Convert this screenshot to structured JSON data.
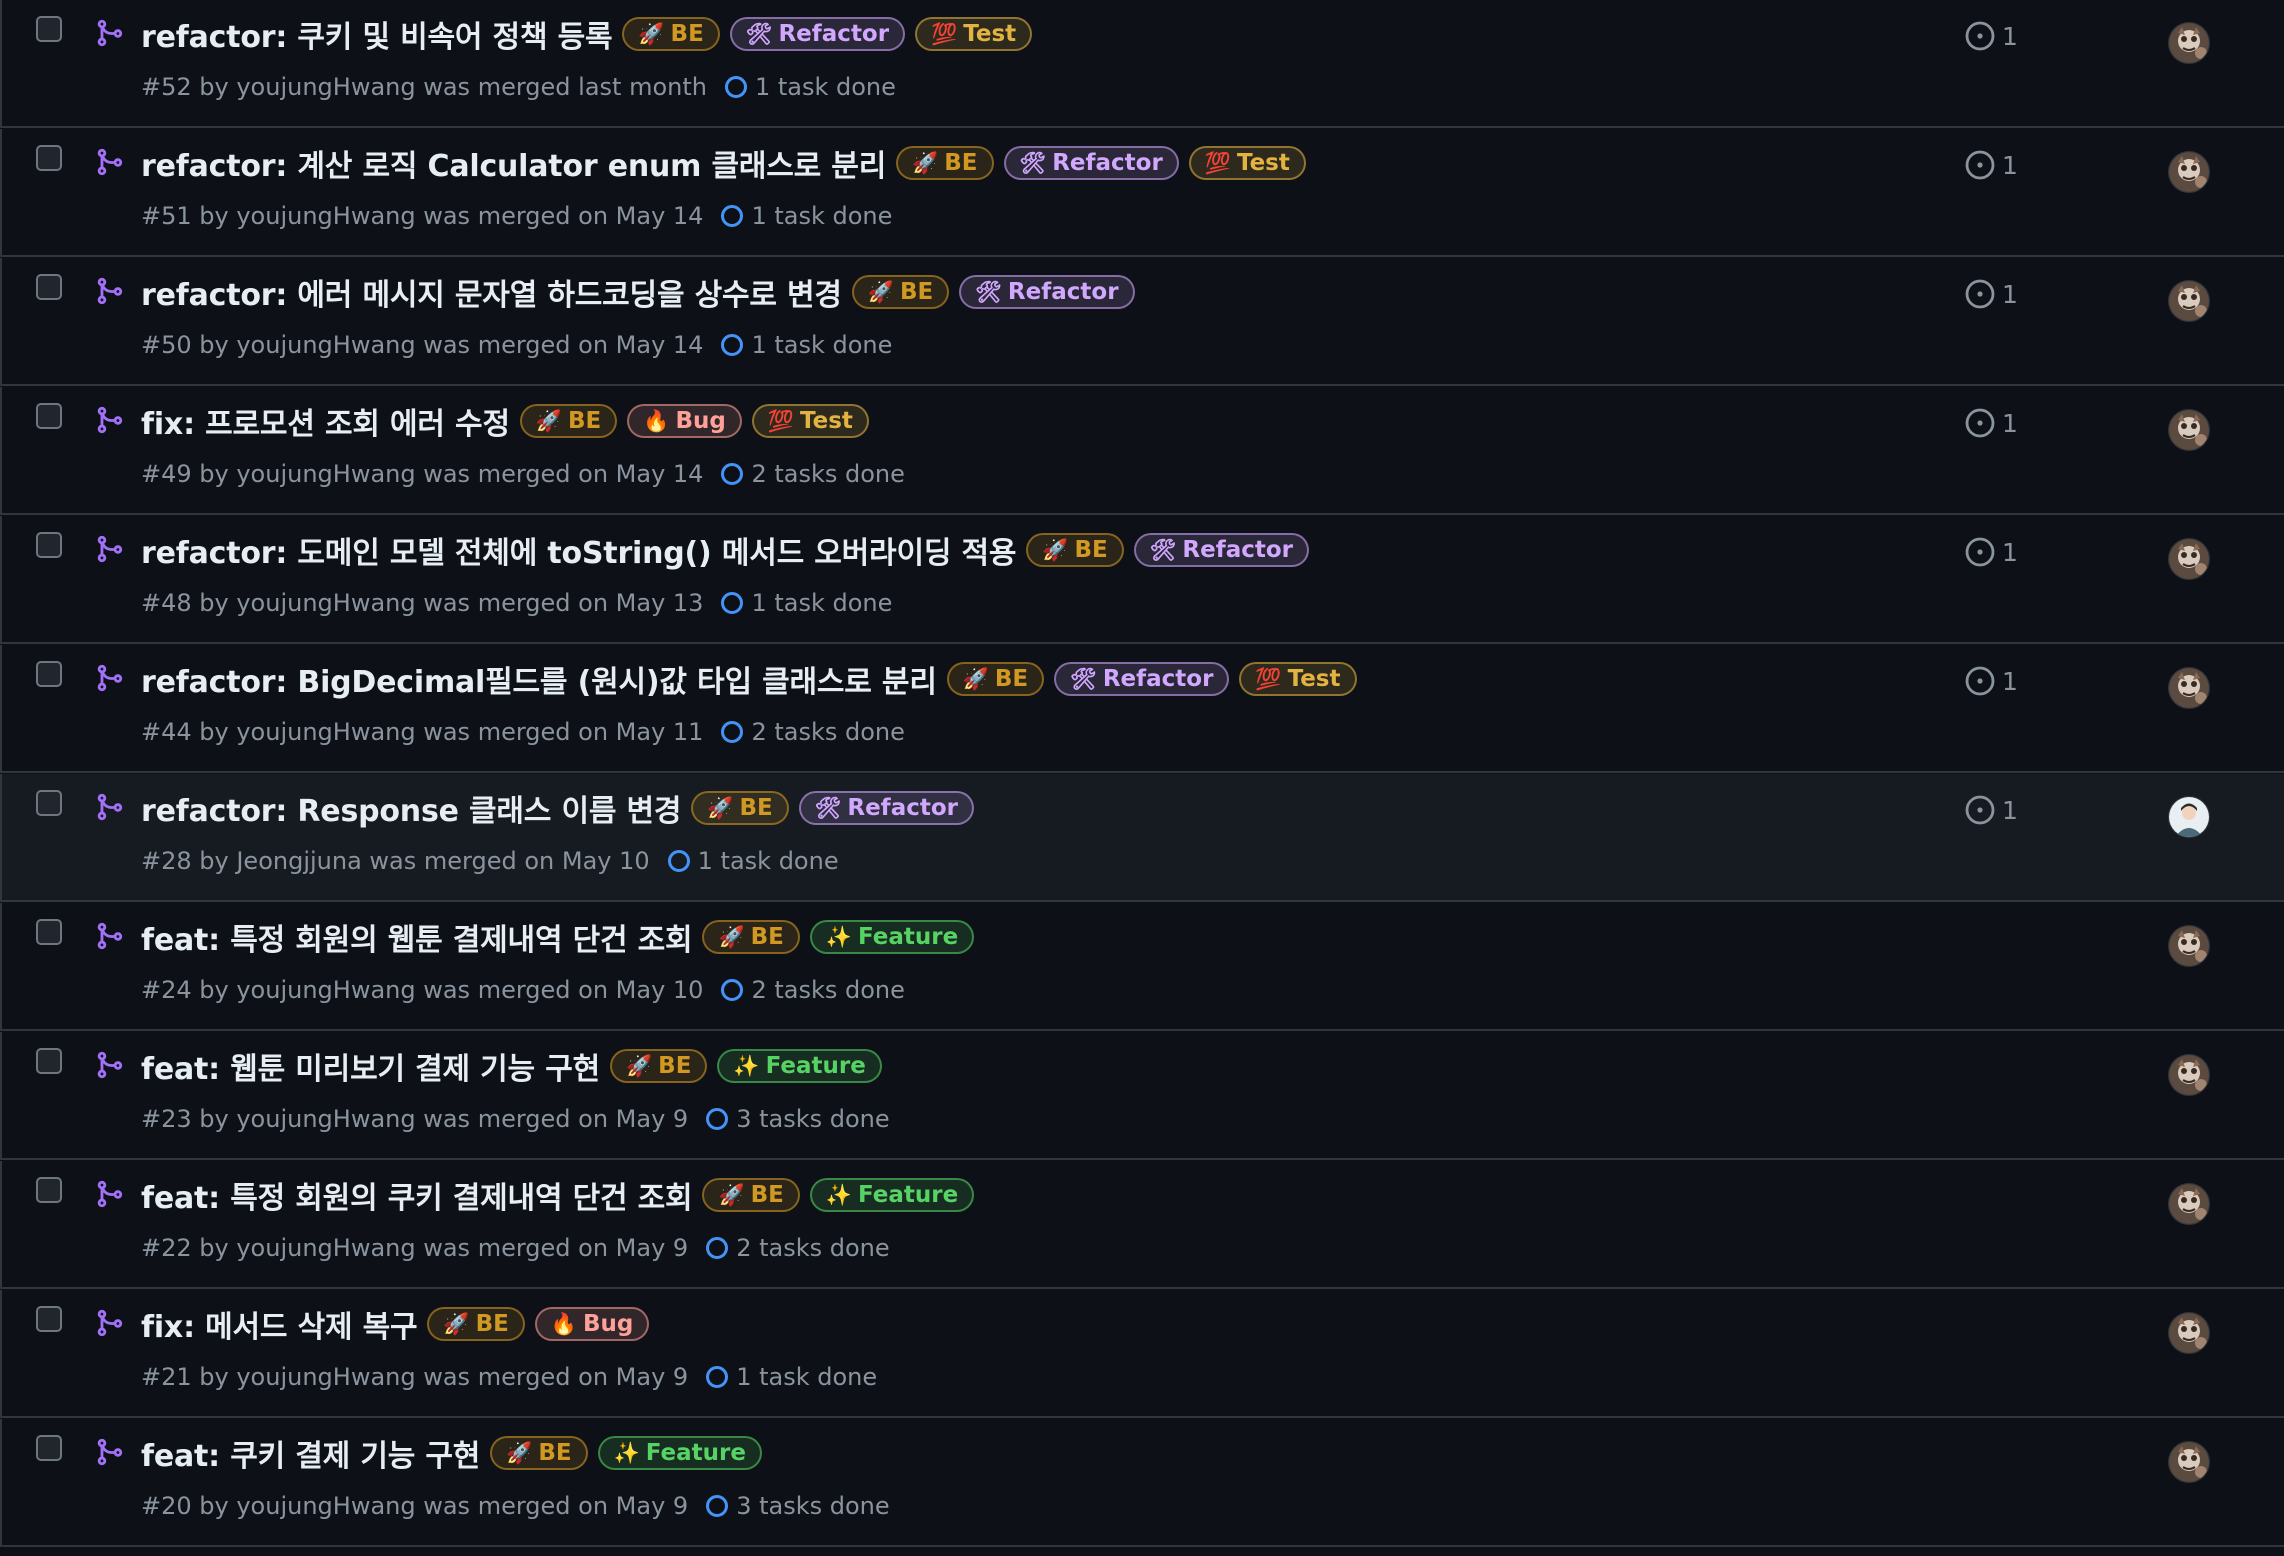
{
  "pull_requests": [
    {
      "title": "refactor: 쿠키 및 비속어 정책 등록",
      "meta": "#52 by youjungHwang was merged last month",
      "tasks": "1 task done",
      "comments": "1",
      "avatar": "youjungHwang",
      "labels": [
        {
          "icon": "🚀",
          "text": "BE",
          "color": "#d29922"
        },
        {
          "icon": "🛠",
          "text": "Refactor",
          "color": "#d2a8ff"
        },
        {
          "icon": "💯",
          "text": "Test",
          "color": "#e3b341"
        }
      ]
    },
    {
      "title": "refactor: 계산 로직 Calculator enum 클래스로 분리",
      "meta": "#51 by youjungHwang was merged on May 14",
      "tasks": "1 task done",
      "comments": "1",
      "avatar": "youjungHwang",
      "labels": [
        {
          "icon": "🚀",
          "text": "BE",
          "color": "#d29922"
        },
        {
          "icon": "🛠",
          "text": "Refactor",
          "color": "#d2a8ff"
        },
        {
          "icon": "💯",
          "text": "Test",
          "color": "#e3b341"
        }
      ]
    },
    {
      "title": "refactor: 에러 메시지 문자열 하드코딩을 상수로 변경",
      "meta": "#50 by youjungHwang was merged on May 14",
      "tasks": "1 task done",
      "comments": "1",
      "avatar": "youjungHwang",
      "labels": [
        {
          "icon": "🚀",
          "text": "BE",
          "color": "#d29922"
        },
        {
          "icon": "🛠",
          "text": "Refactor",
          "color": "#d2a8ff"
        }
      ]
    },
    {
      "title": "fix: 프로모션 조회 에러 수정",
      "meta": "#49 by youjungHwang was merged on May 14",
      "tasks": "2 tasks done",
      "comments": "1",
      "avatar": "youjungHwang",
      "labels": [
        {
          "icon": "🚀",
          "text": "BE",
          "color": "#d29922"
        },
        {
          "icon": "🔥",
          "text": "Bug",
          "color": "#ffa198"
        },
        {
          "icon": "💯",
          "text": "Test",
          "color": "#e3b341"
        }
      ]
    },
    {
      "title": "refactor: 도메인 모델 전체에 toString() 메서드 오버라이딩 적용",
      "meta": "#48 by youjungHwang was merged on May 13",
      "tasks": "1 task done",
      "comments": "1",
      "avatar": "youjungHwang",
      "labels": [
        {
          "icon": "🚀",
          "text": "BE",
          "color": "#d29922"
        },
        {
          "icon": "🛠",
          "text": "Refactor",
          "color": "#d2a8ff"
        }
      ]
    },
    {
      "title": "refactor: BigDecimal필드를 (원시)값 타입 클래스로 분리",
      "meta": "#44 by youjungHwang was merged on May 11",
      "tasks": "2 tasks done",
      "comments": "1",
      "avatar": "youjungHwang",
      "labels": [
        {
          "icon": "🚀",
          "text": "BE",
          "color": "#d29922"
        },
        {
          "icon": "🛠",
          "text": "Refactor",
          "color": "#d2a8ff"
        },
        {
          "icon": "💯",
          "text": "Test",
          "color": "#e3b341"
        }
      ]
    },
    {
      "title": "refactor: Response 클래스 이름 변경",
      "meta": "#28 by Jeongjjuna was merged on May 10",
      "tasks": "1 task done",
      "comments": "1",
      "avatar": "Jeongjjuna",
      "highlight": true,
      "labels": [
        {
          "icon": "🚀",
          "text": "BE",
          "color": "#d29922"
        },
        {
          "icon": "🛠",
          "text": "Refactor",
          "color": "#d2a8ff"
        }
      ]
    },
    {
      "title": "feat: 특정 회원의 웹툰 결제내역 단건 조회",
      "meta": "#24 by youjungHwang was merged on May 10",
      "tasks": "2 tasks done",
      "comments": "",
      "avatar": "youjungHwang",
      "labels": [
        {
          "icon": "🚀",
          "text": "BE",
          "color": "#d29922"
        },
        {
          "icon": "✨",
          "text": "Feature",
          "color": "#56d364"
        }
      ]
    },
    {
      "title": "feat: 웹툰 미리보기 결제 기능 구현",
      "meta": "#23 by youjungHwang was merged on May 9",
      "tasks": "3 tasks done",
      "comments": "",
      "avatar": "youjungHwang",
      "labels": [
        {
          "icon": "🚀",
          "text": "BE",
          "color": "#d29922"
        },
        {
          "icon": "✨",
          "text": "Feature",
          "color": "#56d364"
        }
      ]
    },
    {
      "title": "feat: 특정 회원의 쿠키 결제내역 단건 조회",
      "meta": "#22 by youjungHwang was merged on May 9",
      "tasks": "2 tasks done",
      "comments": "",
      "avatar": "youjungHwang",
      "labels": [
        {
          "icon": "🚀",
          "text": "BE",
          "color": "#d29922"
        },
        {
          "icon": "✨",
          "text": "Feature",
          "color": "#56d364"
        }
      ]
    },
    {
      "title": "fix: 메서드 삭제 복구",
      "meta": "#21 by youjungHwang was merged on May 9",
      "tasks": "1 task done",
      "comments": "",
      "avatar": "youjungHwang",
      "labels": [
        {
          "icon": "🚀",
          "text": "BE",
          "color": "#d29922"
        },
        {
          "icon": "🔥",
          "text": "Bug",
          "color": "#ffa198"
        }
      ]
    },
    {
      "title": "feat: 쿠키 결제 기능 구현",
      "meta": "#20 by youjungHwang was merged on May 9",
      "tasks": "3 tasks done",
      "comments": "",
      "avatar": "youjungHwang",
      "labels": [
        {
          "icon": "🚀",
          "text": "BE",
          "color": "#d29922"
        },
        {
          "icon": "✨",
          "text": "Feature",
          "color": "#56d364"
        }
      ]
    }
  ],
  "theme": {
    "background": "#0d1117",
    "border": "#30363d",
    "merged_icon": "#a371f7",
    "task_ring": "#4493f8",
    "muted": "#8b949e"
  }
}
